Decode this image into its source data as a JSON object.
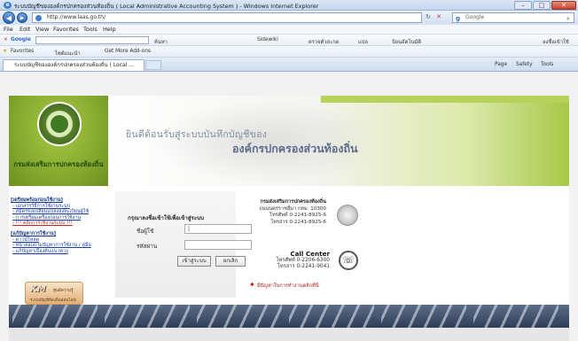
{
  "window": {
    "title": "ระบบบัญชีขององค์กรปกครองส่วนท้องถิ่น ( Local Administrative Accounting System ) - Windows Internet Explorer",
    "btn_min": "–",
    "btn_max": "□",
    "btn_close": "✕"
  },
  "address_bar": {
    "url": "http://www.laas.go.th/",
    "search_placeholder": "Google",
    "back": "◀",
    "forward": "▶"
  },
  "menu": [
    "File",
    "Edit",
    "View",
    "Favorites",
    "Tools",
    "Help"
  ],
  "google_toolbar": {
    "label": "Google",
    "items": [
      "ค้นหา",
      "Sidewiki",
      "ตรวจตัวสะกด",
      "แปล",
      "ป้อนอัตโนมัติ"
    ],
    "right": "ลงชื่อเข้าใช้"
  },
  "favorites_bar": {
    "favorites": "Favorites",
    "link1": "ไซต์แนะนำ",
    "link2": "Get More Add-ons"
  },
  "tab": {
    "label": "ระบบบัญชีขององค์กรปกครองส่วนท้องถิ่น ( Local ...",
    "right_tools": [
      "Page",
      "Safety",
      "Tools"
    ]
  },
  "header": {
    "dept_name": "กรมส่งเสริมการปกครองท้องถิ่น",
    "banner_line1": "ยินดีต้อนรับสู่ระบบบันทึกบัญชีของ",
    "banner_line2": "องค์กรปกครองส่วนท้องถิ่น"
  },
  "login": {
    "prompt": "กรุณาลงชื่อเข้าใช้เพื่อเข้าสู่ระบบ",
    "username_label": "ชื่อผู้ใช้",
    "password_label": "รหัสผ่าน",
    "username_value": "|",
    "login_button": "เข้าสู่ระบบ",
    "cancel_button": "ยกเลิก"
  },
  "contact": {
    "title": "กรมส่งเสริมการปกครองท้องถิ่น",
    "line1": "ถนนนครราชสีมา กทม. 10300",
    "line2": "โทรศัพท์ 0-2241-8925-6",
    "line3": "โทรสาร 0-2241-8925-6"
  },
  "callcenter": {
    "title": "Call Center",
    "phone": "โทรศัพท์ 0-2206-6300",
    "fax": "โทรสาร 0-2241-9041"
  },
  "problem_link": "มีปัญหาในการทำงานคลิกที่นี่",
  "left_menu": {
    "section1_head": "[เตรียมพร้อมก่อนใช้งาน]",
    "section1_items": [
      "- เอกสารวิธีการใช้งานระบบ",
      "- สมัครขอเปลี่ยนแปลงลงทะเบียนผู้ใช้",
      "- การเตรียมเครื่องก่อนการใช้งาน",
      "- !!! คลิกการใช้งานระบบ !!!"
    ],
    "section2_head": "[แก้ปัญหาการใช้งาน]",
    "section2_items": [
      "- ดาวน์โหลด",
      "- หน้าสอบถามปัญหาการใช้งาน / คู่มือ",
      "- แก้ปัญหาเบื้องต้นแนวทาง"
    ]
  },
  "km_badge": {
    "title": "KM",
    "sub1": "ศูนย์ความรู้",
    "sub2": "ระบบบัญชีท้องถิ่นออนไลน์"
  }
}
